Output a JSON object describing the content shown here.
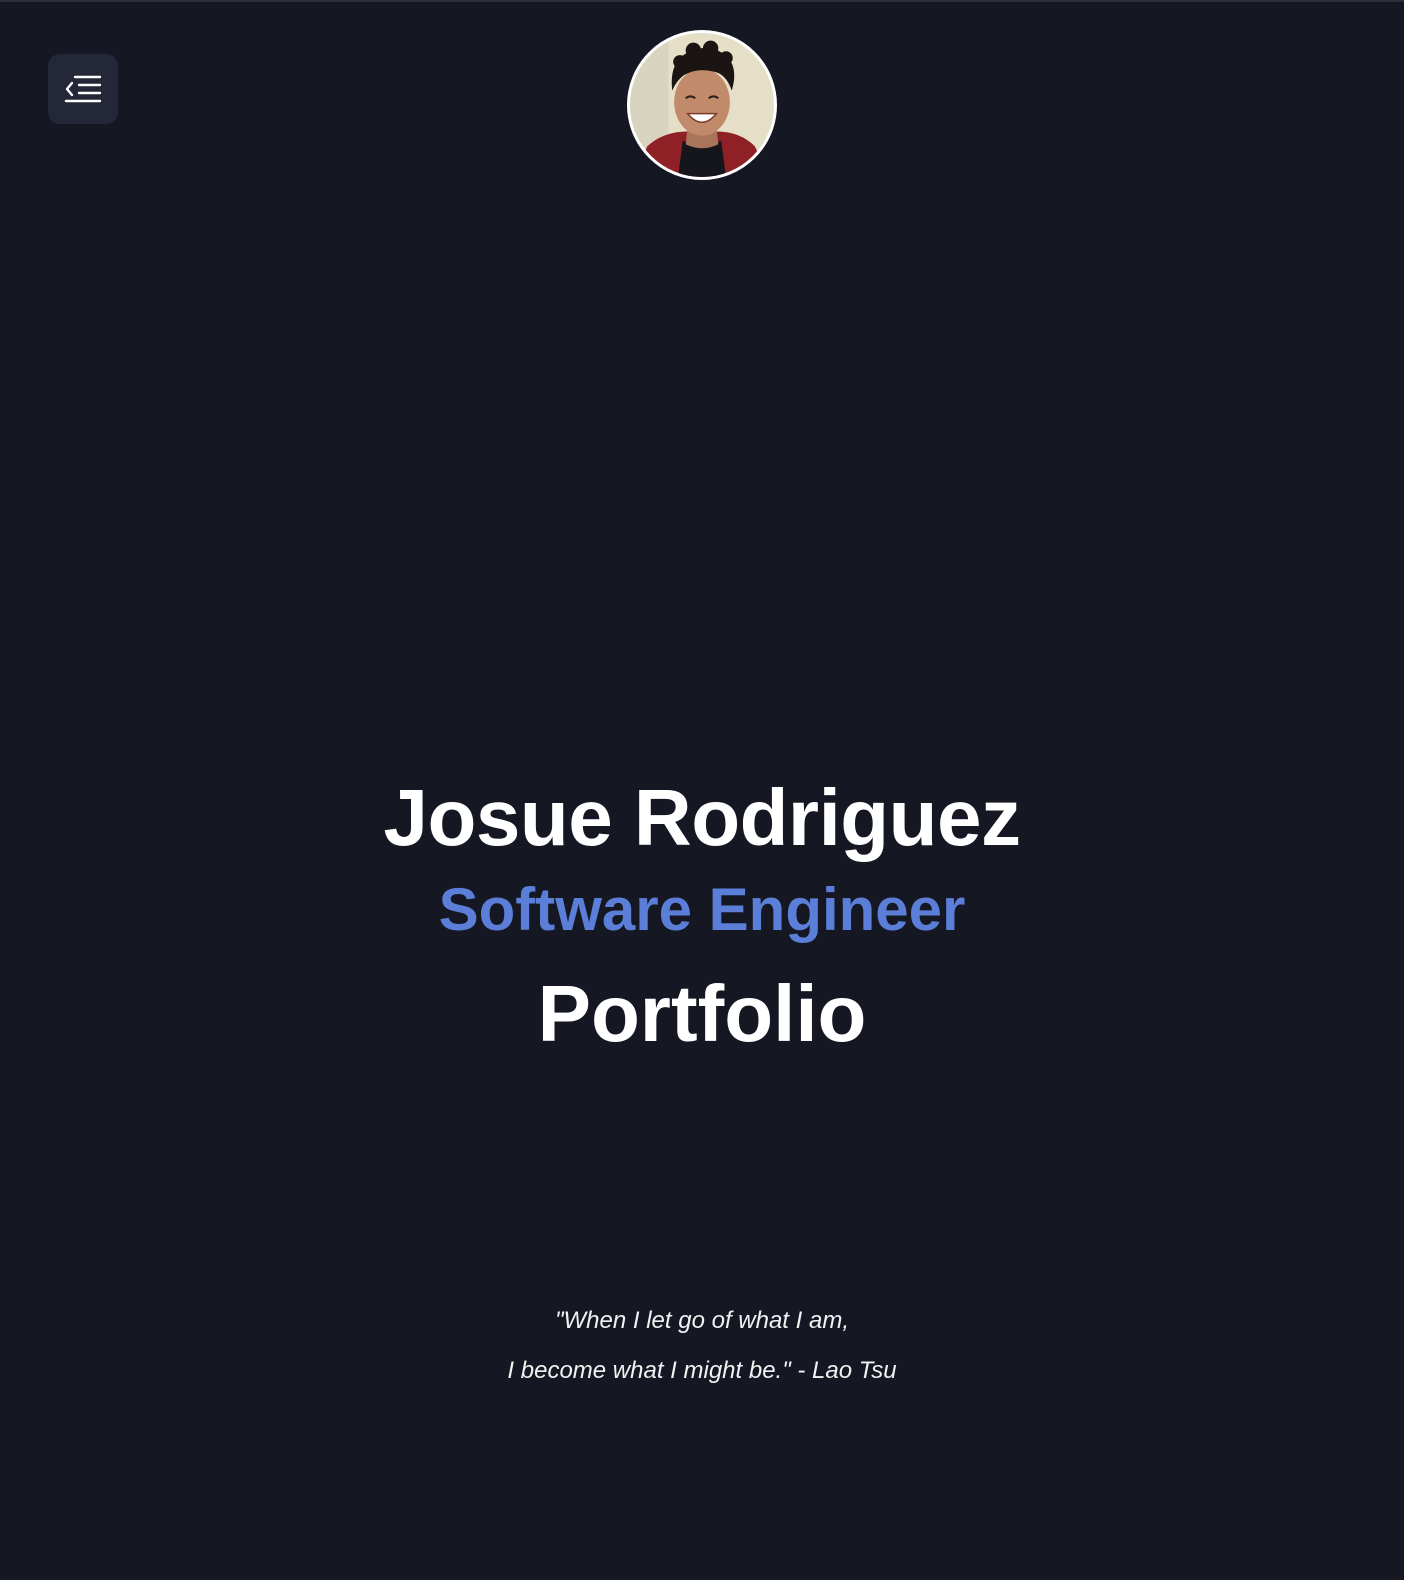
{
  "header": {
    "menu_icon": "menu-collapse-icon",
    "avatar_alt": "Josue Rodriguez profile photo"
  },
  "hero": {
    "name": "Josue Rodriguez",
    "role": "Software Engineer",
    "title": "Portfolio"
  },
  "quote": {
    "line1": "\"When I let go of what I am,",
    "line2": "I become what I might be.\" - Lao Tsu"
  },
  "colors": {
    "background": "#151823",
    "accent": "#5b7fd8",
    "text": "#ffffff"
  }
}
